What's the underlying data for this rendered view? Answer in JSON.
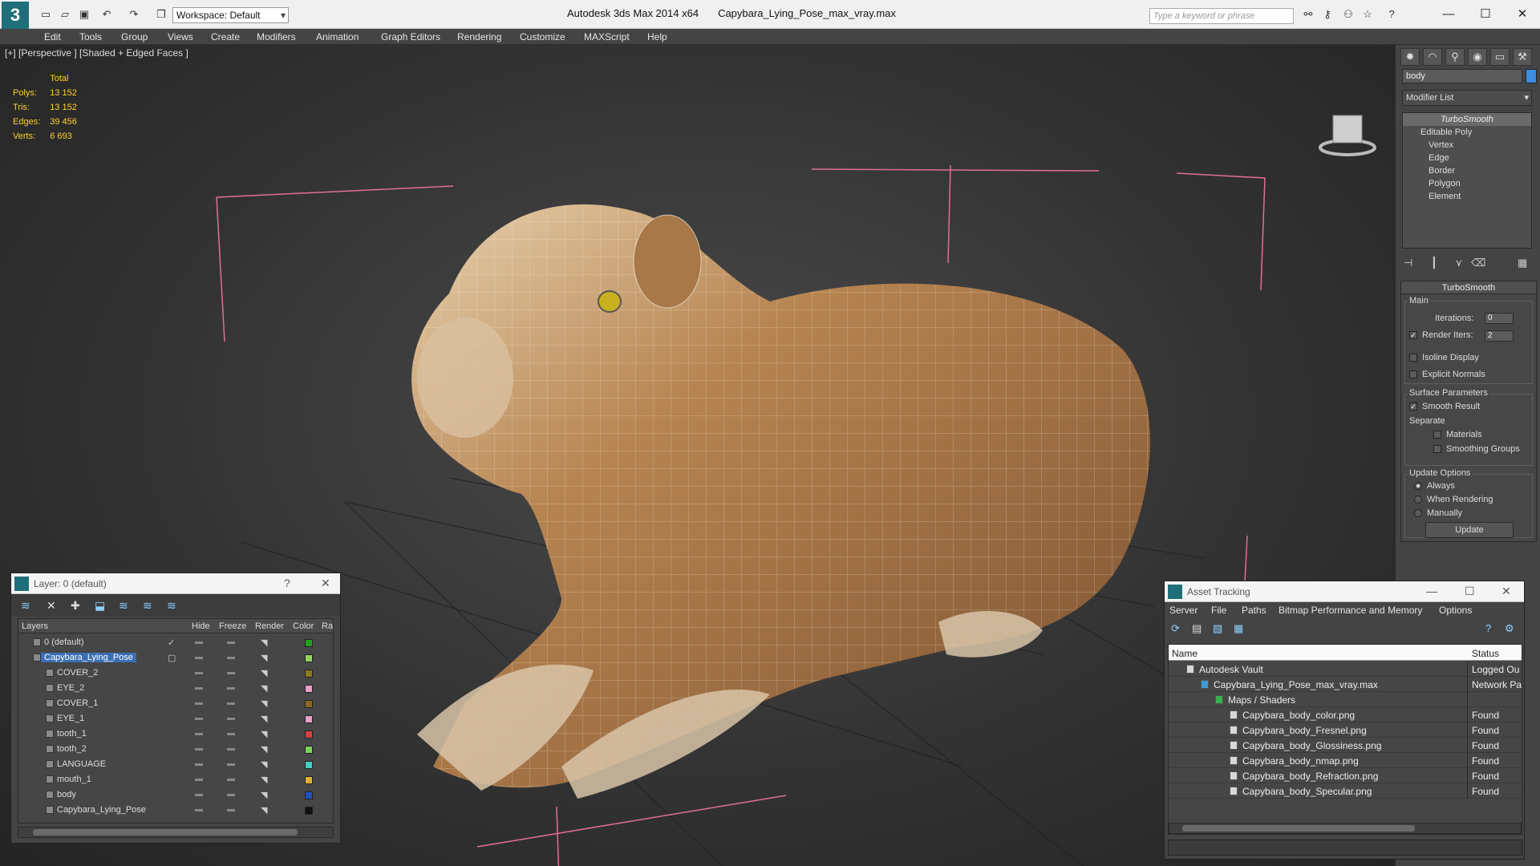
{
  "app": {
    "title": "Autodesk 3ds Max  2014 x64",
    "file": "Capybara_Lying_Pose_max_vray.max",
    "workspace": "Workspace: Default",
    "search_placeholder": "Type a keyword or phrase"
  },
  "menu": [
    "Edit",
    "Tools",
    "Group",
    "Views",
    "Create",
    "Modifiers",
    "Animation",
    "Graph Editors",
    "Rendering",
    "Customize",
    "MAXScript",
    "Help"
  ],
  "viewport": {
    "label": "[+] [Perspective ] [Shaded + Edged Faces ]",
    "stats": {
      "header": "Total",
      "rows": [
        {
          "label": "Polys:",
          "value": "13 152"
        },
        {
          "label": "Tris:",
          "value": "13 152"
        },
        {
          "label": "Edges:",
          "value": "39 456"
        },
        {
          "label": "Verts:",
          "value": "6 693"
        }
      ]
    }
  },
  "command_panel": {
    "object_name": "body",
    "modifier_list": "Modifier List",
    "stack": [
      "TurboSmooth",
      "Editable Poly",
      "Vertex",
      "Edge",
      "Border",
      "Polygon",
      "Element"
    ],
    "rollout": {
      "title": "TurboSmooth",
      "main_label": "Main",
      "iterations_label": "Iterations:",
      "iterations_value": "0",
      "render_iters_label": "Render Iters:",
      "render_iters_value": "2",
      "isoline": "Isoline Display",
      "explicit_normals": "Explicit Normals",
      "surface_params": "Surface Parameters",
      "smooth_result": "Smooth Result",
      "separate": "Separate",
      "materials": "Materials",
      "smoothing_groups": "Smoothing Groups",
      "update_options": "Update Options",
      "always": "Always",
      "when_rendering": "When Rendering",
      "manually": "Manually",
      "update_button": "Update"
    }
  },
  "layer_panel": {
    "title": "Layer: 0 (default)",
    "help": "?",
    "columns": [
      "Layers",
      "Hide",
      "Freeze",
      "Render",
      "Color",
      "Ra"
    ],
    "rows": [
      {
        "name": "0 (default)",
        "color": "#1fa31f"
      },
      {
        "name": "Capybara_Lying_Pose",
        "color": "#8fd45a"
      },
      {
        "name": "COVER_2",
        "color": "#8a7a1a"
      },
      {
        "name": "EYE_2",
        "color": "#e8a0c8"
      },
      {
        "name": "COVER_1",
        "color": "#8a6a1a"
      },
      {
        "name": "EYE_1",
        "color": "#e8a0c8"
      },
      {
        "name": "tooth_1",
        "color": "#d84040"
      },
      {
        "name": "tooth_2",
        "color": "#7ad45a"
      },
      {
        "name": "LANGUAGE",
        "color": "#40d0c0"
      },
      {
        "name": "mouth_1",
        "color": "#e0b030"
      },
      {
        "name": "body",
        "color": "#2050c0"
      },
      {
        "name": "Capybara_Lying_Pose",
        "color": "#111111"
      }
    ]
  },
  "asset_tracking": {
    "title": "Asset Tracking",
    "menu": [
      "Server",
      "File",
      "Paths",
      "Bitmap Performance and Memory",
      "Options"
    ],
    "columns": [
      "Name",
      "Status"
    ],
    "rows": [
      {
        "name": "Autodesk Vault",
        "status": "Logged Ou"
      },
      {
        "name": "Capybara_Lying_Pose_max_vray.max",
        "status": "Network Pa"
      },
      {
        "name": "Maps / Shaders",
        "status": ""
      },
      {
        "name": "Capybara_body_color.png",
        "status": "Found"
      },
      {
        "name": "Capybara_body_Fresnel.png",
        "status": "Found"
      },
      {
        "name": "Capybara_body_Glossiness.png",
        "status": "Found"
      },
      {
        "name": "Capybara_body_nmap.png",
        "status": "Found"
      },
      {
        "name": "Capybara_body_Refraction.png",
        "status": "Found"
      },
      {
        "name": "Capybara_body_Specular.png",
        "status": "Found"
      }
    ]
  }
}
